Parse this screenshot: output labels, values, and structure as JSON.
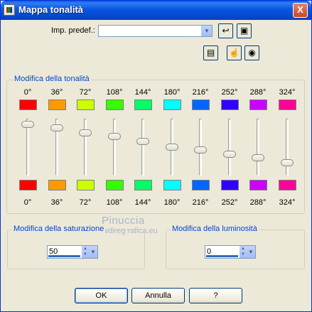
{
  "window": {
    "title": "Mappa tonalità",
    "close": "X"
  },
  "preset": {
    "label": "Imp. predef.:",
    "value": ""
  },
  "icons": {
    "app": "app-icon",
    "reset": "undo-arrow-icon",
    "save": "floppy-disk-icon",
    "preview_window": "window-icon",
    "proof": "hand-eye-icon",
    "preview": "eye-icon"
  },
  "hue_group": {
    "title": "Modifica della tonalità",
    "columns": [
      {
        "top_label": "0°",
        "bottom_label": "0°",
        "top_color": "#ff0000",
        "bottom_color": "#ff0000",
        "level": 0.96
      },
      {
        "top_label": "36°",
        "bottom_label": "36°",
        "top_color": "#ff9900",
        "bottom_color": "#ff9900",
        "level": 0.89
      },
      {
        "top_label": "72°",
        "bottom_label": "72°",
        "top_color": "#ccff00",
        "bottom_color": "#ccff00",
        "level": 0.78
      },
      {
        "top_label": "108°",
        "bottom_label": "108°",
        "top_color": "#33ff00",
        "bottom_color": "#33ff00",
        "level": 0.71
      },
      {
        "top_label": "144°",
        "bottom_label": "144°",
        "top_color": "#00ff66",
        "bottom_color": "#00ff66",
        "level": 0.61
      },
      {
        "top_label": "180°",
        "bottom_label": "180°",
        "top_color": "#00ffff",
        "bottom_color": "#00ffff",
        "level": 0.5
      },
      {
        "top_label": "216°",
        "bottom_label": "216°",
        "top_color": "#0066ff",
        "bottom_color": "#0066ff",
        "level": 0.44
      },
      {
        "top_label": "252°",
        "bottom_label": "252°",
        "top_color": "#3300ff",
        "bottom_color": "#3300ff",
        "level": 0.36
      },
      {
        "top_label": "288°",
        "bottom_label": "288°",
        "top_color": "#cc00ff",
        "bottom_color": "#cc00ff",
        "level": 0.28
      },
      {
        "top_label": "324°",
        "bottom_label": "324°",
        "top_color": "#ff0099",
        "bottom_color": "#ff0099",
        "level": 0.18
      }
    ]
  },
  "watermark": {
    "line1": "Pinuccia",
    "line2": "www.maidireg rafica.eu"
  },
  "saturation": {
    "title": "Modifica della saturazione",
    "value": "50"
  },
  "luminosity": {
    "title": "Modifica della luminosità",
    "value": "0"
  },
  "buttons": {
    "ok": "OK",
    "cancel": "Annulla",
    "help": "?"
  }
}
